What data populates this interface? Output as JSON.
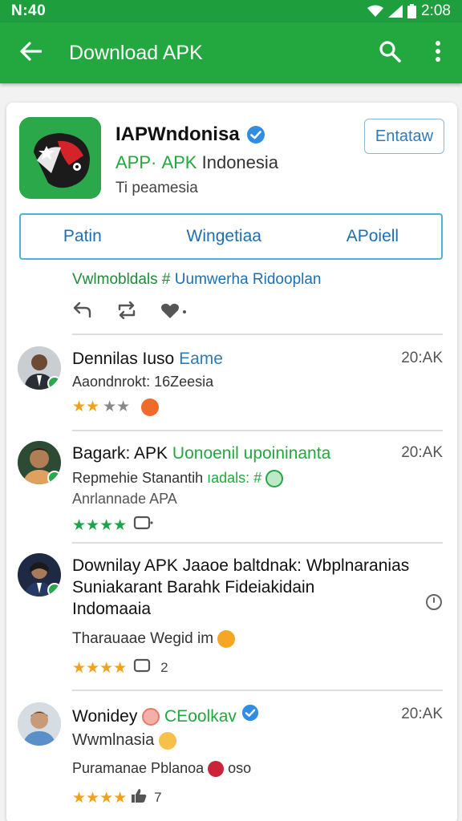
{
  "status_bar": {
    "time_left": "N:40",
    "time_right": "2:08"
  },
  "app_bar": {
    "title": "Download APK",
    "back_icon": "arrow-back-icon",
    "search_icon": "search-icon",
    "more_icon": "more-vert-icon"
  },
  "app": {
    "name": "IAPWndonisa",
    "sub_green": "APP· ΑPK",
    "sub_gray": "Indonesia",
    "meta": "Ti peamesia",
    "install_label": "Entataw"
  },
  "tabs": [
    {
      "label": "Patin"
    },
    {
      "label": "Wingetiaa"
    },
    {
      "label": "APoiell"
    }
  ],
  "tagline": {
    "green": "Vwlmobldals #",
    "blue": "Uumwerha Ridooplan"
  },
  "reviews": [
    {
      "title": "Dennilas Iuso",
      "title_accent": "Eame",
      "time": "20:AK",
      "sub": "Aaondnrokt: 16Zeesia",
      "stars": "★★",
      "count": ""
    },
    {
      "title": "Bagark: APK",
      "title_accent": "Uonoenil upoininanta",
      "time": "20:AK",
      "sub": "Repmehie Stanantih",
      "sub_green": "ıadals: #",
      "sub2": "Anrlannade APA",
      "stars": "★★★★",
      "count": ""
    },
    {
      "title_line1": "Downilay APK Jaaoe baltdnak: Wbplnaranias",
      "title_line2": "Suniakarant Barahk Fideiakidain",
      "title_line3": "Indomaaia",
      "sub": "Tharauaae Wegid im",
      "stars": "★★★★",
      "count": "2"
    },
    {
      "title": "Wonidey",
      "title_accent": "CEoolkav",
      "time": "20:AK",
      "sub": "Wwmlnasia",
      "sub2": "Puramanae Pblanoa",
      "sub2_tail": "oso",
      "stars": "★★★★",
      "count": "7"
    }
  ],
  "colors": {
    "primary": "#22a83f",
    "link": "#2e7bb8",
    "star": "#f2a21a"
  }
}
